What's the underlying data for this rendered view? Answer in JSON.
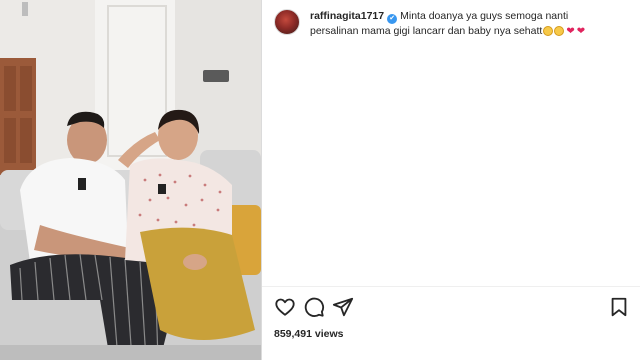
{
  "post": {
    "username": "raffinagita1717",
    "verified_mark": "✔",
    "caption": "Minta doanya ya guys semoga nanti persalinan mama gigi lancarr dan baby nya sehatt",
    "caption_emojis": [
      "grinning-face-emoji",
      "grinning-face-emoji",
      "red-heart-emoji",
      "red-heart-emoji"
    ],
    "heart_glyph": "❤",
    "views": "859,491 views"
  },
  "actions": [
    "heart-icon",
    "comment-icon",
    "share-icon",
    "bookmark-icon"
  ],
  "colors": {
    "text": "#262626",
    "verified": "#3897f0",
    "divider": "#dbdbdb",
    "heart": "#e0245e"
  }
}
